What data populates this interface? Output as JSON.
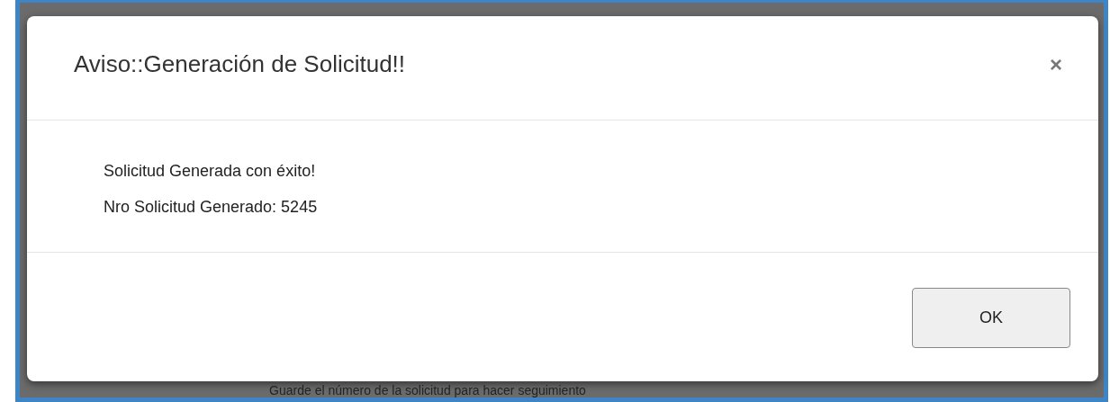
{
  "dialog": {
    "title": "Aviso::Generación de Solicitud!!",
    "close": "×",
    "message": [
      "Solicitud Generada con éxito!",
      "Nro Solicitud Generado: 5245"
    ],
    "buttons": [
      "OK"
    ]
  },
  "background": {
    "note": "Guarde el número de la solicitud para hacer seguimiento"
  }
}
